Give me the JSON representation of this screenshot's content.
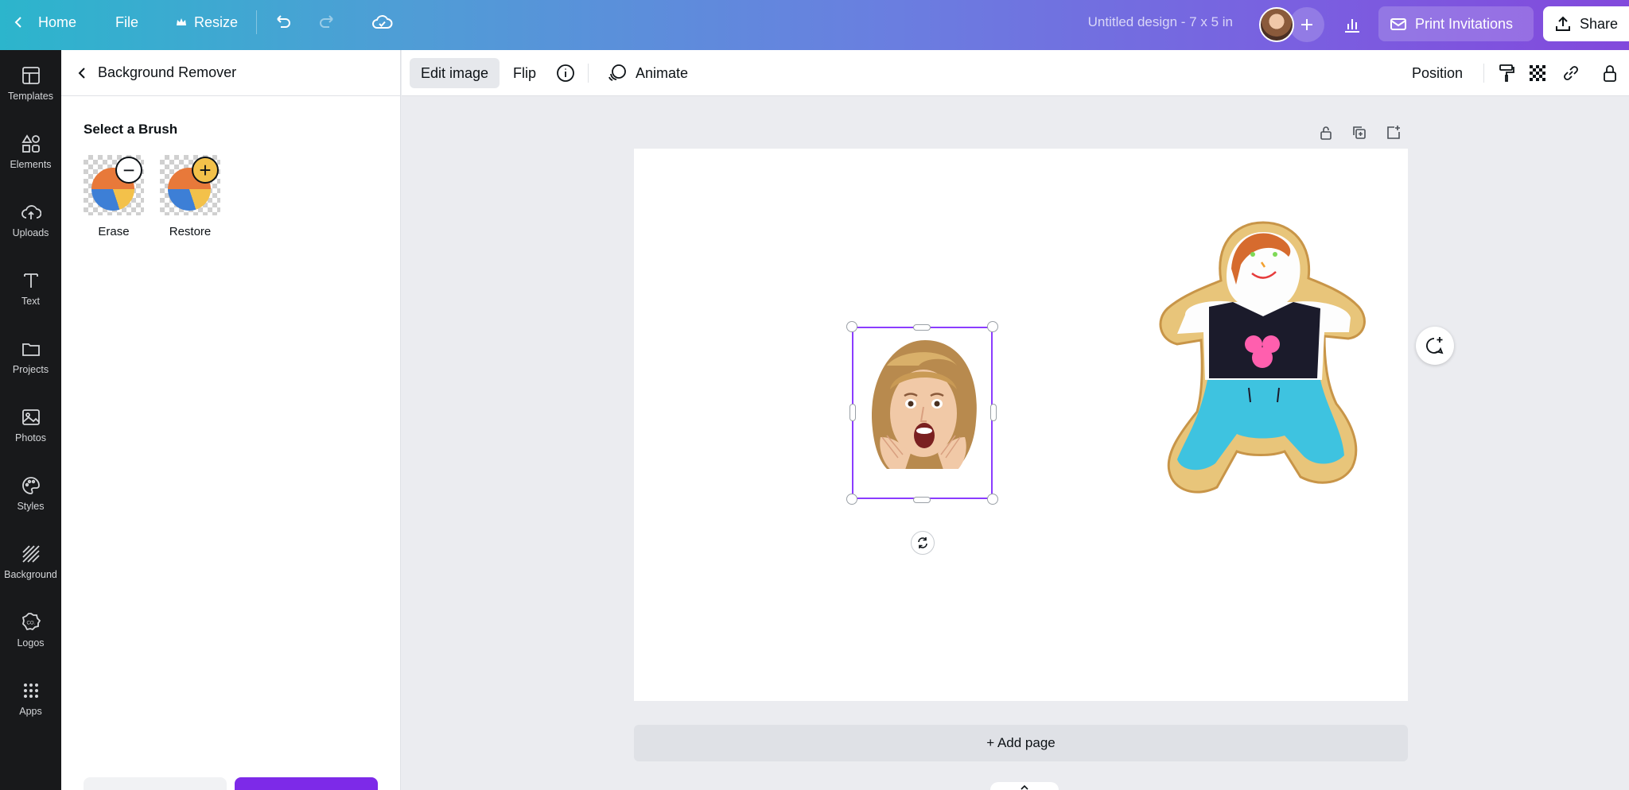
{
  "topbar": {
    "home_label": "Home",
    "file_label": "File",
    "resize_label": "Resize",
    "doc_title": "Untitled design - 7 x 5 in",
    "print_label": "Print Invitations",
    "share_label": "Share"
  },
  "rail": {
    "items": [
      {
        "label": "Templates"
      },
      {
        "label": "Elements"
      },
      {
        "label": "Uploads"
      },
      {
        "label": "Text"
      },
      {
        "label": "Projects"
      },
      {
        "label": "Photos"
      },
      {
        "label": "Styles"
      },
      {
        "label": "Background"
      },
      {
        "label": "Logos"
      },
      {
        "label": "Apps"
      }
    ]
  },
  "panel": {
    "back_title": "Background Remover",
    "section_title": "Select a Brush",
    "brushes": [
      {
        "label": "Erase",
        "symbol": "−"
      },
      {
        "label": "Restore",
        "symbol": "+"
      }
    ]
  },
  "context_toolbar": {
    "edit_image": "Edit image",
    "flip": "Flip",
    "animate": "Animate",
    "position": "Position"
  },
  "canvas": {
    "add_page": "+ Add page"
  },
  "colors": {
    "accent": "#8b3dff",
    "rail_bg": "#18191b"
  }
}
